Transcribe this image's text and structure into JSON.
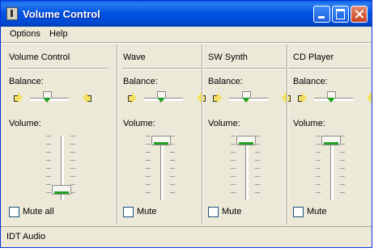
{
  "window": {
    "title": "Volume Control",
    "icon": "volume-control-app-icon"
  },
  "menu": [
    "Options",
    "Help"
  ],
  "labels": {
    "balance": "Balance:",
    "volume": "Volume:"
  },
  "columns": [
    {
      "title": "Volume Control",
      "mute_label": "Mute all",
      "muted": false,
      "volume_level": 0.1,
      "balance": 0.5
    },
    {
      "title": "Wave",
      "mute_label": "Mute",
      "muted": false,
      "volume_level": 1.0,
      "balance": 0.5
    },
    {
      "title": "SW Synth",
      "mute_label": "Mute",
      "muted": false,
      "volume_level": 1.0,
      "balance": 0.5
    },
    {
      "title": "CD Player",
      "mute_label": "Mute",
      "muted": false,
      "volume_level": 1.0,
      "balance": 0.5
    }
  ],
  "status": "IDT Audio",
  "colors": {
    "title_bar": "#0054e3",
    "face": "#ece9d8",
    "accent_green": "#21a121"
  }
}
